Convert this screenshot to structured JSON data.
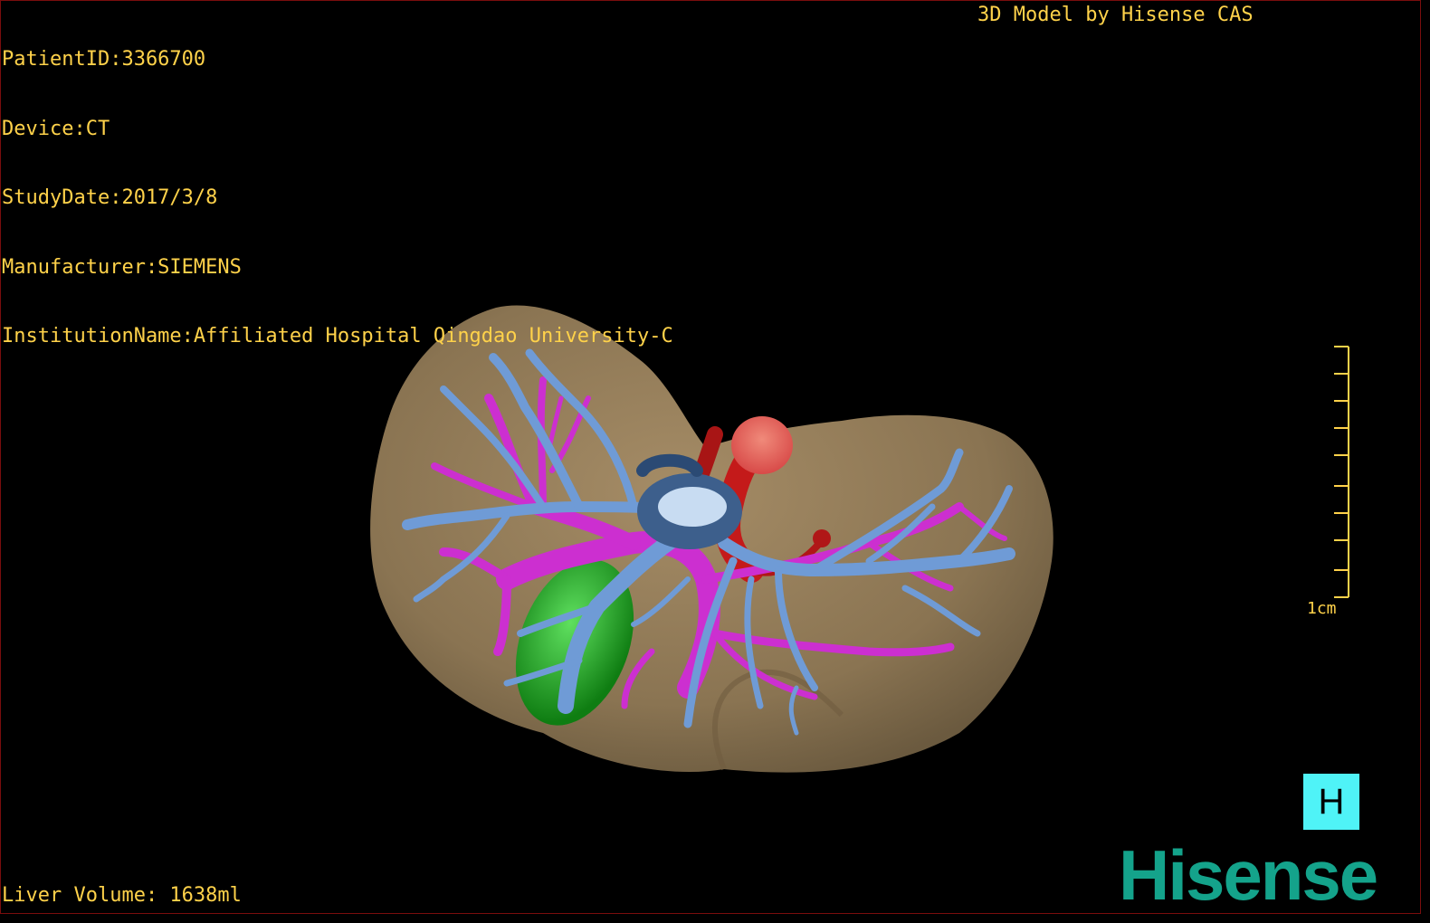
{
  "patient_info": {
    "patient_id": "PatientID:3366700",
    "device": "Device:CT",
    "study_date": "StudyDate:2017/3/8",
    "manufacturer": "Manufacturer:SIEMENS",
    "institution": "InstitutionName:Affiliated Hospital Qingdao University-C"
  },
  "credit": "3D Model by Hisense CAS",
  "liver_volume": "Liver Volume: 1638ml",
  "scale_bar": {
    "label": "1cm"
  },
  "view_button": {
    "label": "H"
  },
  "brand": "Hisense",
  "colors": {
    "overlay_text": "#ffd24a",
    "liver": "#8c7653",
    "portal_vein": "#cc2fd0",
    "hepatic_vein": "#6f9bd6",
    "artery": "#cc1b1b",
    "gallbladder": "#1fa81f",
    "view_button_bg": "#4ff3f7",
    "brand": "#14a38b"
  }
}
